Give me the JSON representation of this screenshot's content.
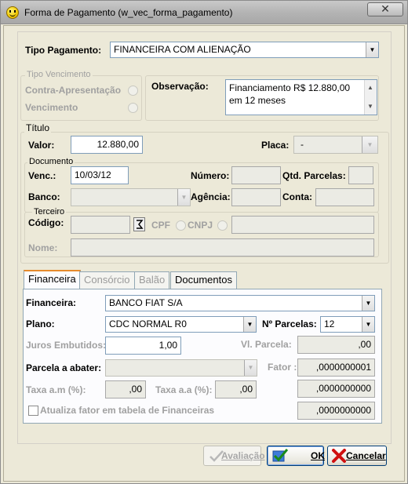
{
  "window": {
    "title": "Forma de Pagamento (w_vec_forma_pagamento)",
    "close_glyph": "✕"
  },
  "tipo_pagamento": {
    "label": "Tipo Pagamento:",
    "value": "FINANCEIRA COM ALIENAÇÃO"
  },
  "tipo_vencimento": {
    "group_title": "Tipo Vencimento",
    "options": [
      "Contra-Apresentação",
      "Vencimento"
    ]
  },
  "observacao": {
    "label": "Observação:",
    "lines": [
      "Financiamento R$ 12.880,00",
      "em 12 meses"
    ]
  },
  "titulo": {
    "group_title": "Título",
    "valor_label": "Valor:",
    "valor": "12.880,00",
    "placa_label": "Placa:",
    "placa": "-"
  },
  "documento": {
    "group_title": "Documento",
    "venc_label": "Venc.:",
    "venc": "10/03/12",
    "numero_label": "Número:",
    "numero": "",
    "qtd_parcelas_label": "Qtd. Parcelas:",
    "qtd_parcelas": "",
    "banco_label": "Banco:",
    "banco": "",
    "agencia_label": "Agência:",
    "agencia": "",
    "conta_label": "Conta:",
    "conta": ""
  },
  "terceiro": {
    "group_title": "Terceiro",
    "codigo_label": "Código:",
    "codigo": "",
    "cpf_label": "CPF",
    "cnpj_label": "CNPJ",
    "doc": "",
    "nome_label": "Nome:",
    "nome": ""
  },
  "tabs": [
    "Financeira",
    "Consórcio",
    "Balão",
    "Documentos"
  ],
  "financeira": {
    "financeira_label": "Financeira:",
    "financeira": "BANCO FIAT S/A",
    "plano_label": "Plano:",
    "plano": "CDC NORMAL R0",
    "n_parcelas_label": "Nº Parcelas:",
    "n_parcelas": "12",
    "juros_label": "Juros Embutidos:",
    "juros": "1,00",
    "vl_parcela_label": "Vl. Parcela:",
    "vl_parcela": ",00",
    "parcela_abater_label": "Parcela a abater:",
    "parcela_abater": "",
    "fator_label": "Fator :",
    "fator": ",0000000001",
    "taxa_am_label": "Taxa a.m (%):",
    "taxa_am": ",00",
    "taxa_aa_label": "Taxa a.a (%):",
    "taxa_aa": ",00",
    "fator2": ",0000000000",
    "atualiza_label": "Atualiza fator em tabela de Financeiras",
    "fator3": ",0000000000"
  },
  "buttons": {
    "avaliacao": "Avaliação",
    "ok": "OK",
    "cancelar": "Cancelar"
  },
  "icons": {
    "app": "smiley-icon",
    "close": "close-icon",
    "dropdown": "chevron-down-icon",
    "lookup": "lookup-icon",
    "check": "checkmark-icon",
    "cancel": "x-icon"
  }
}
